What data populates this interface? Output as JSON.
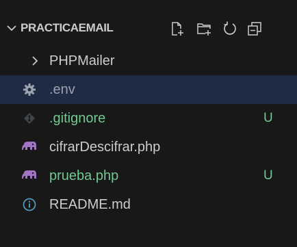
{
  "explorer": {
    "folder_title": "PRACTICAEMAIL",
    "actions": [
      {
        "name": "new-file-icon"
      },
      {
        "name": "new-folder-icon"
      },
      {
        "name": "refresh-icon"
      },
      {
        "name": "collapse-all-icon"
      }
    ],
    "items": [
      {
        "label": "PHPMailer",
        "icon": "chevron-right-icon",
        "type": "folder",
        "badge": ""
      },
      {
        "label": ".env",
        "icon": "gear-icon",
        "type": "file",
        "badge": ""
      },
      {
        "label": ".gitignore",
        "icon": "git-diamond-icon",
        "type": "file",
        "badge": "U"
      },
      {
        "label": "cifrarDescifrar.php",
        "icon": "php-elephant-icon",
        "type": "file",
        "badge": ""
      },
      {
        "label": "prueba.php",
        "icon": "php-elephant-icon",
        "type": "file",
        "badge": "U"
      },
      {
        "label": "README.md",
        "icon": "info-icon",
        "type": "file",
        "badge": ""
      }
    ]
  },
  "colors": {
    "background": "#181818",
    "selected_row": "#1f2b44",
    "untracked_green": "#73c991",
    "php_purple": "#a074c4",
    "info_blue": "#519aba"
  }
}
